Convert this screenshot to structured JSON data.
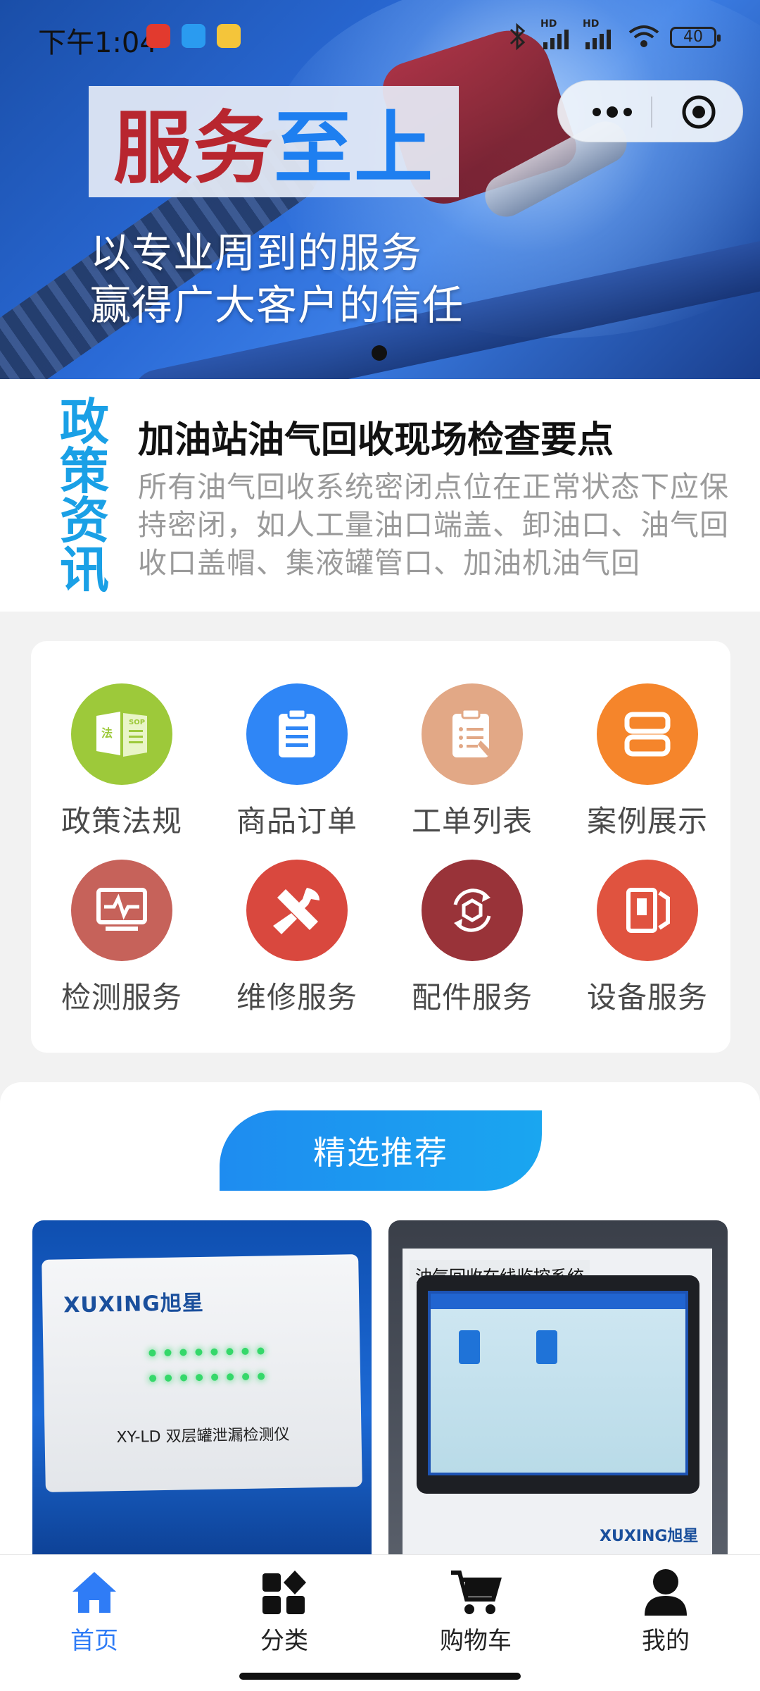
{
  "status_bar": {
    "time": "下午1:04",
    "network_1": "HD",
    "network_2": "HD",
    "battery": "40"
  },
  "banner": {
    "title_red": "服务",
    "title_blue": "至上",
    "slogan_line1": "以专业周到的服务",
    "slogan_line2": "赢得广大客户的信任"
  },
  "news": {
    "tag": "政策资讯",
    "title": "加油站油气回收现场检查要点",
    "body": "所有油气回收系统密闭点位在正常状态下应保持密闭，如人工量油口端盖、卸油口、油气回收口盖帽、集液罐管口、加油机油气回"
  },
  "services": [
    {
      "label": "政策法规",
      "icon": "policy-sop-icon",
      "color": "#9dc93a"
    },
    {
      "label": "商品订单",
      "icon": "clipboard-icon",
      "color": "#2f86f6"
    },
    {
      "label": "工单列表",
      "icon": "checklist-icon",
      "color": "#e2a886"
    },
    {
      "label": "案例展示",
      "icon": "case-icon",
      "color": "#f5852b"
    },
    {
      "label": "检测服务",
      "icon": "monitor-pulse-icon",
      "color": "#c6625a"
    },
    {
      "label": "维修服务",
      "icon": "tools-icon",
      "color": "#d9483e"
    },
    {
      "label": "配件服务",
      "icon": "parts-cycle-icon",
      "color": "#993339"
    },
    {
      "label": "设备服务",
      "icon": "device-icon",
      "color": "#e0533f"
    }
  ],
  "recommend": {
    "title": "精选推荐",
    "card1": {
      "brand": "XUXING旭星",
      "model": "XY-LD 双层罐泄漏检测仪"
    },
    "card2": {
      "sign": "油气回收在线监控系统",
      "brand": "XUXING旭星"
    }
  },
  "tabbar": [
    {
      "label": "首页",
      "icon": "home-icon",
      "active": true
    },
    {
      "label": "分类",
      "icon": "category-icon",
      "active": false
    },
    {
      "label": "购物车",
      "icon": "cart-icon",
      "active": false
    },
    {
      "label": "我的",
      "icon": "user-icon",
      "active": false
    }
  ],
  "colors": {
    "accent": "#2f7cf6",
    "news_tag": "#1aa0e6",
    "recommend_gradient_start": "#1e8cf0"
  }
}
